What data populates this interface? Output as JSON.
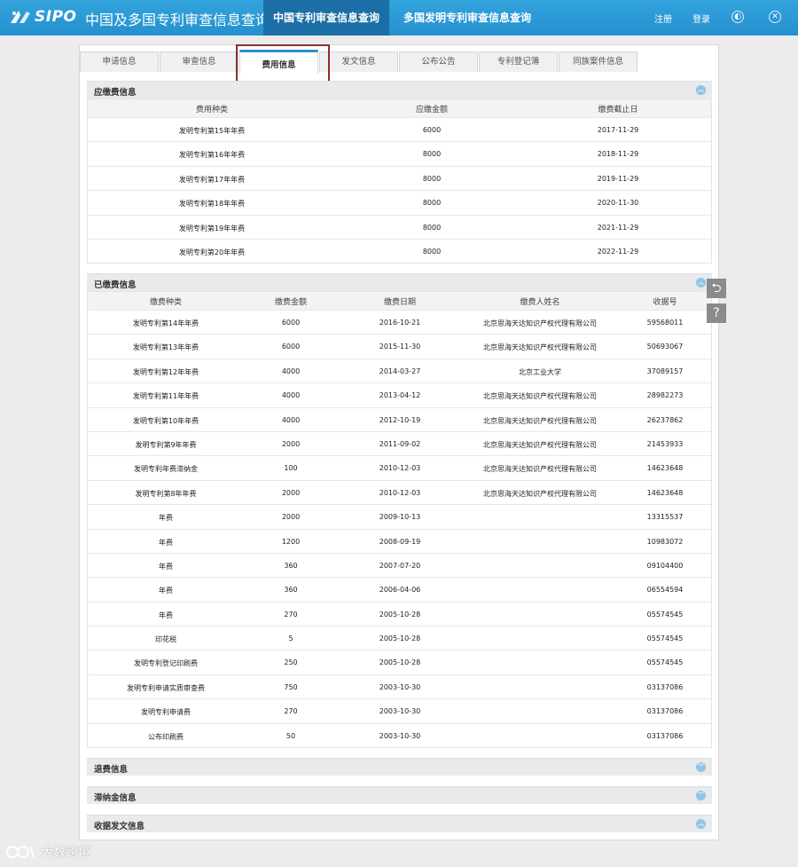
{
  "header": {
    "logo_text": "SIPO",
    "title": "中国及多国专利审查信息查询",
    "tabs": [
      {
        "label": "中国专利审查信息查询",
        "active": true
      },
      {
        "label": "多国发明专利审查信息查询",
        "active": false
      }
    ],
    "register_label": "注册",
    "login_label": "登录",
    "globe_icon": "globe-icon",
    "close_icon": "close-icon"
  },
  "sub_tabs": [
    {
      "label": "申请信息",
      "active": false
    },
    {
      "label": "审查信息",
      "active": false
    },
    {
      "label": "费用信息",
      "active": true
    },
    {
      "label": "发文信息",
      "active": false
    },
    {
      "label": "公布公告",
      "active": false
    },
    {
      "label": "专利登记簿",
      "active": false
    },
    {
      "label": "同族案件信息",
      "active": false
    }
  ],
  "due_fees": {
    "title": "应缴费信息",
    "columns": [
      "费用种类",
      "应缴金额",
      "缴费截止日"
    ],
    "rows": [
      [
        "发明专利第15年年费",
        "6000",
        "2017-11-29"
      ],
      [
        "发明专利第16年年费",
        "8000",
        "2018-11-29"
      ],
      [
        "发明专利第17年年费",
        "8000",
        "2019-11-29"
      ],
      [
        "发明专利第18年年费",
        "8000",
        "2020-11-30"
      ],
      [
        "发明专利第19年年费",
        "8000",
        "2021-11-29"
      ],
      [
        "发明专利第20年年费",
        "8000",
        "2022-11-29"
      ]
    ]
  },
  "paid_fees": {
    "title": "已缴费信息",
    "columns": [
      "缴费种类",
      "缴费金额",
      "缴费日期",
      "缴费人姓名",
      "收据号"
    ],
    "rows": [
      [
        "发明专利第14年年费",
        "6000",
        "2016-10-21",
        "北京思海天达知识产权代理有限公司",
        "59568011"
      ],
      [
        "发明专利第13年年费",
        "6000",
        "2015-11-30",
        "北京思海天达知识产权代理有限公司",
        "50693067"
      ],
      [
        "发明专利第12年年费",
        "4000",
        "2014-03-27",
        "北京工业大学",
        "37089157"
      ],
      [
        "发明专利第11年年费",
        "4000",
        "2013-04-12",
        "北京思海天达知识产权代理有限公司",
        "28982273"
      ],
      [
        "发明专利第10年年费",
        "4000",
        "2012-10-19",
        "北京思海天达知识产权代理有限公司",
        "26237862"
      ],
      [
        "发明专利第9年年费",
        "2000",
        "2011-09-02",
        "北京思海天达知识产权代理有限公司",
        "21453933"
      ],
      [
        "发明专利年费滞纳金",
        "100",
        "2010-12-03",
        "北京思海天达知识产权代理有限公司",
        "14623648"
      ],
      [
        "发明专利第8年年费",
        "2000",
        "2010-12-03",
        "北京思海天达知识产权代理有限公司",
        "14623648"
      ],
      [
        "年费",
        "2000",
        "2009-10-13",
        "",
        "13315537"
      ],
      [
        "年费",
        "1200",
        "2008-09-19",
        "",
        "10983072"
      ],
      [
        "年费",
        "360",
        "2007-07-20",
        "",
        "09104400"
      ],
      [
        "年费",
        "360",
        "2006-04-06",
        "",
        "06554594"
      ],
      [
        "年费",
        "270",
        "2005-10-28",
        "",
        "05574545"
      ],
      [
        "印花税",
        "5",
        "2005-10-28",
        "",
        "05574545"
      ],
      [
        "发明专利登记印刷费",
        "250",
        "2005-10-28",
        "",
        "05574545"
      ],
      [
        "发明专利申请实质审查费",
        "750",
        "2003-10-30",
        "",
        "03137086"
      ],
      [
        "发明专利申请费",
        "270",
        "2003-10-30",
        "",
        "03137086"
      ],
      [
        "公布印刷费",
        "50",
        "2003-10-30",
        "",
        "03137086"
      ]
    ]
  },
  "collapsed_sections": [
    {
      "title": "退费信息"
    },
    {
      "title": "滞纳金信息"
    },
    {
      "title": "收据发文信息"
    }
  ],
  "side_buttons": [
    {
      "icon": "back-arrow-icon",
      "glyph": "⮌"
    },
    {
      "icon": "help-icon",
      "glyph": "?"
    }
  ],
  "watermark_text": "大数跨境",
  "colors": {
    "header_blue": "#2590cf",
    "active_tab": "#1c6fa6",
    "highlight_box": "#8b2e2e"
  }
}
